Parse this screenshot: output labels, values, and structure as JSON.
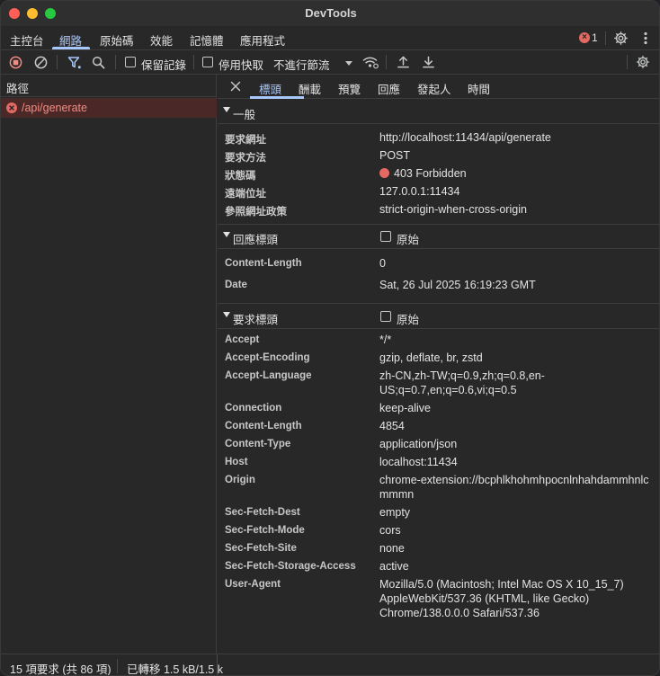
{
  "window": {
    "title": "DevTools"
  },
  "main_tabs": [
    "主控台",
    "網路",
    "原始碼",
    "效能",
    "記憶體",
    "應用程式"
  ],
  "error_count": "1",
  "toolbar": {
    "preserve_log": "保留記錄",
    "disable_cache": "停用快取",
    "throttling": "不進行節流"
  },
  "left": {
    "column_header": "路徑",
    "request_name": "/api/generate",
    "status_summary": "15 項要求 (共 86 項)",
    "transferred": "已轉移 1.5 kB/1.5 k"
  },
  "detail_tabs": [
    "標頭",
    "酬載",
    "預覽",
    "回應",
    "發起人",
    "時間"
  ],
  "general": {
    "title": "一般",
    "rows": [
      {
        "k": "要求網址",
        "v": "http://localhost:11434/api/generate"
      },
      {
        "k": "要求方法",
        "v": "POST"
      },
      {
        "k": "狀態碼",
        "v": "403 Forbidden"
      },
      {
        "k": "遠端位址",
        "v": "127.0.0.1:11434"
      },
      {
        "k": "參照網址政策",
        "v": "strict-origin-when-cross-origin"
      }
    ]
  },
  "response_headers": {
    "title": "回應標頭",
    "raw_label": "原始",
    "rows": [
      {
        "k": "Content-Length",
        "v": "0"
      },
      {
        "k": "Date",
        "v": "Sat, 26 Jul 2025 16:19:23 GMT"
      }
    ]
  },
  "request_headers": {
    "title": "要求標頭",
    "raw_label": "原始",
    "rows": [
      {
        "k": "Accept",
        "v": "*/*"
      },
      {
        "k": "Accept-Encoding",
        "v": "gzip, deflate, br, zstd"
      },
      {
        "k": "Accept-Language",
        "v": "zh-CN,zh-TW;q=0.9,zh;q=0.8,en-US;q=0.7,en;q=0.6,vi;q=0.5"
      },
      {
        "k": "Connection",
        "v": "keep-alive"
      },
      {
        "k": "Content-Length",
        "v": "4854"
      },
      {
        "k": "Content-Type",
        "v": "application/json"
      },
      {
        "k": "Host",
        "v": "localhost:11434"
      },
      {
        "k": "Origin",
        "v": "chrome-extension://bcphlkhohmhpocnlnhahdammhnlcmmmn"
      },
      {
        "k": "Sec-Fetch-Dest",
        "v": "empty"
      },
      {
        "k": "Sec-Fetch-Mode",
        "v": "cors"
      },
      {
        "k": "Sec-Fetch-Site",
        "v": "none"
      },
      {
        "k": "Sec-Fetch-Storage-Access",
        "v": "active"
      },
      {
        "k": "User-Agent",
        "v": "Mozilla/5.0 (Macintosh; Intel Mac OS X 10_15_7) AppleWebKit/537.36 (KHTML, like Gecko) Chrome/138.0.0.0 Safari/537.36"
      }
    ]
  },
  "colors": {
    "accent": "#a8c7fa",
    "error": "#e46962"
  }
}
